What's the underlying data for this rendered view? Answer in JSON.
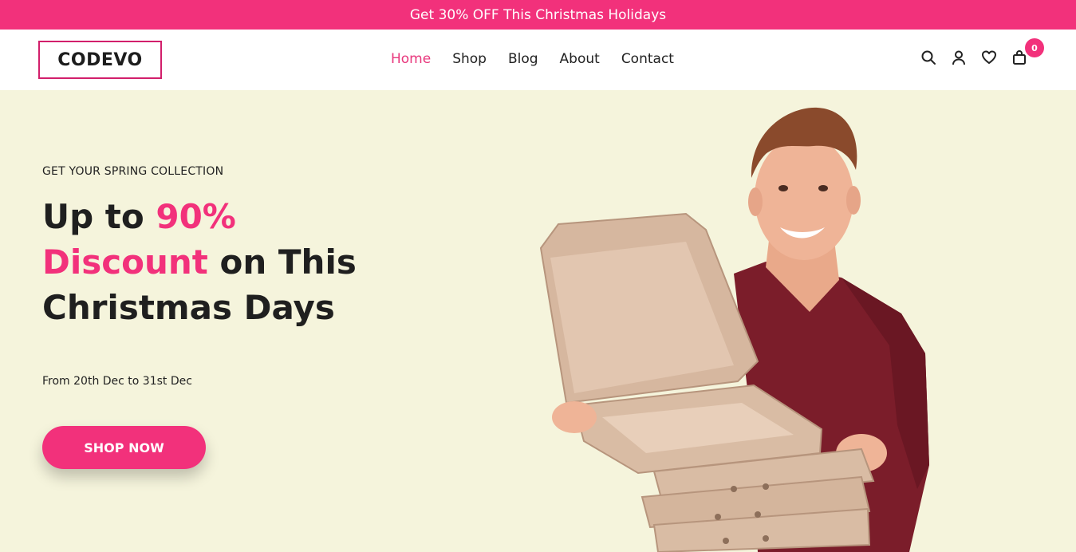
{
  "promo": {
    "text": "Get 30% OFF This Christmas Holidays"
  },
  "header": {
    "logo": "CODEVO",
    "nav": [
      {
        "label": "Home",
        "active": true
      },
      {
        "label": "Shop",
        "active": false
      },
      {
        "label": "Blog",
        "active": false
      },
      {
        "label": "About",
        "active": false
      },
      {
        "label": "Contact",
        "active": false
      }
    ],
    "icons": [
      "search-icon",
      "user-icon",
      "heart-icon",
      "bag-icon"
    ],
    "cart_count": "0"
  },
  "hero": {
    "eyebrow": "GET YOUR SPRING COLLECTION",
    "headline": {
      "part1": "Up to ",
      "part2_pink": "90%",
      "part3_pink": "Discount",
      "part4": " on This",
      "part5": "Christmas Days"
    },
    "dates": "From 20th Dec to 31st Dec",
    "cta_label": "SHOP NOW"
  },
  "colors": {
    "accent": "#f2317b",
    "hero_bg": "#f5f4dc",
    "text": "#1f1f1f"
  }
}
